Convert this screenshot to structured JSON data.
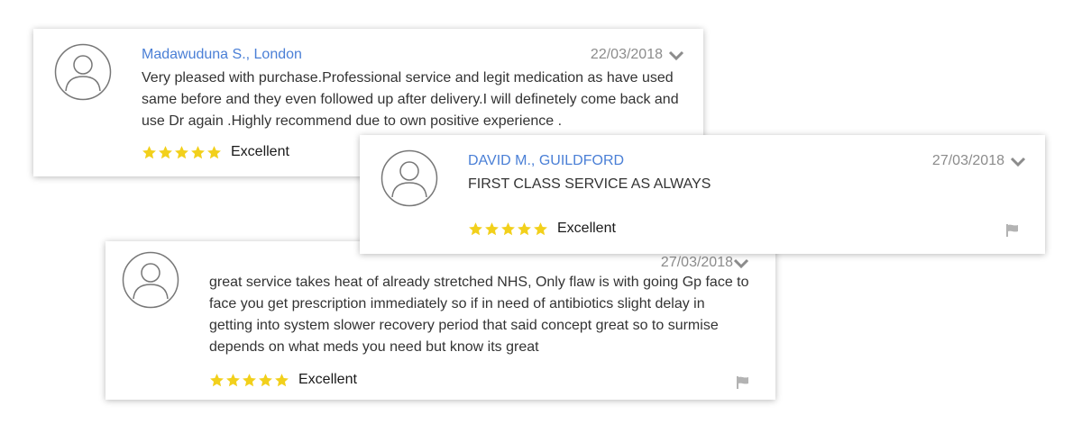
{
  "colors": {
    "reviewer_name": "#4a7fd6",
    "date": "#8c8c8c",
    "star": "#f2d01b",
    "icon_gray": "#b3b3b3"
  },
  "icons": {
    "avatar": "user-avatar-icon",
    "chevron": "chevron-down-icon",
    "star": "star-icon",
    "flag": "flag-icon"
  },
  "reviews": [
    {
      "reviewer": "Madawuduna S., London",
      "date": "22/03/2018",
      "text": "Very pleased with purchase.Professional service and legit medication as have used same before and they even followed up after delivery.I will definetely come back and use Dr again .Highly recommend due to own positive experience .",
      "stars": 5,
      "rating_label": "Excellent"
    },
    {
      "reviewer": "DAVID M., GUILDFORD",
      "date": "27/03/2018",
      "text": "FIRST CLASS SERVICE AS ALWAYS",
      "stars": 5,
      "rating_label": "Excellent"
    },
    {
      "reviewer": "",
      "date": "27/03/2018",
      "text": "great service takes heat of already stretched NHS, Only flaw is with going Gp face to face you get prescription immediately so if in need of antibiotics slight delay in getting into system slower recovery period that said concept great so to surmise depends on what meds you need but know its great",
      "stars": 5,
      "rating_label": "Excellent"
    }
  ]
}
